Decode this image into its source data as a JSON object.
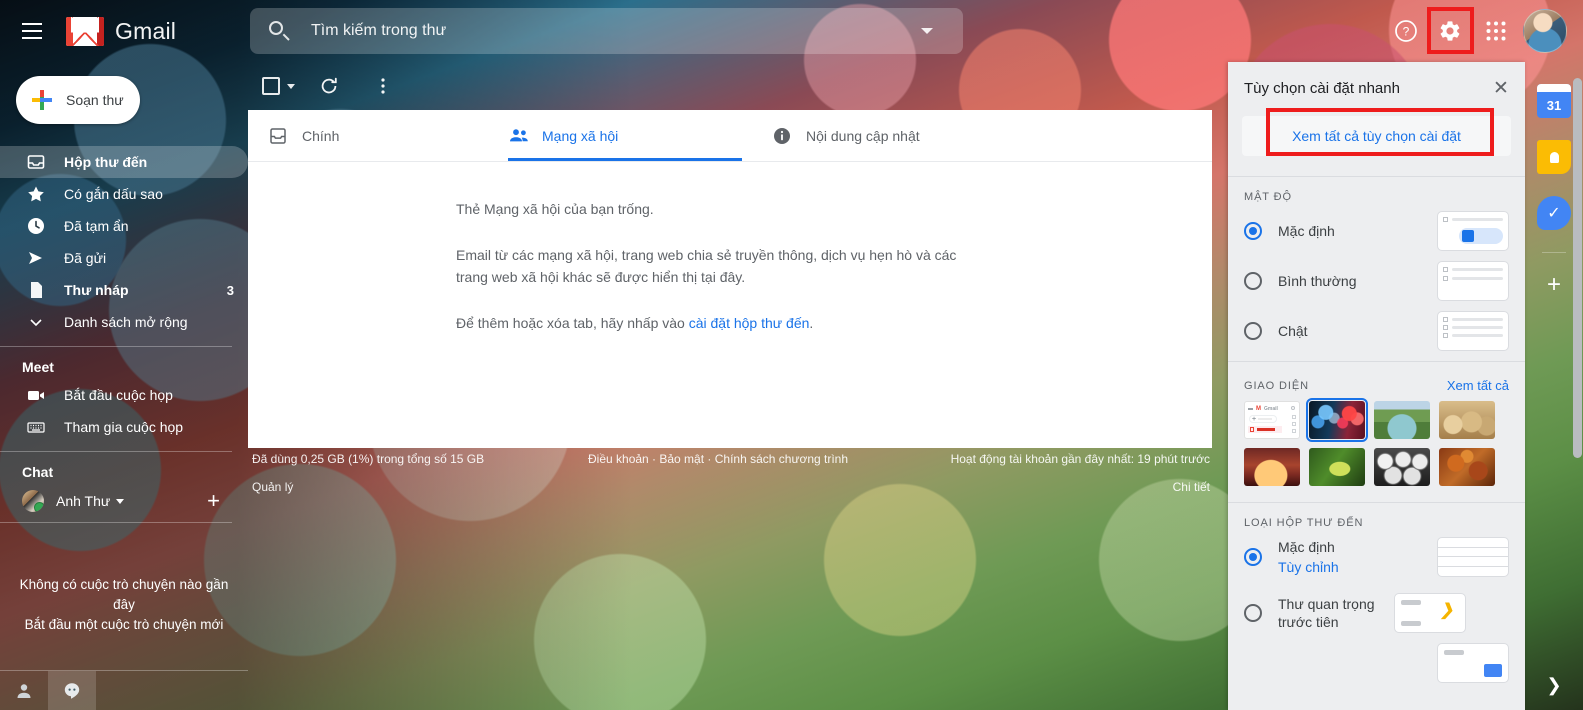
{
  "header": {
    "menu_icon": "hamburger-icon",
    "brand": "Gmail",
    "search": {
      "placeholder": "Tìm kiếm trong thư",
      "value": "",
      "search_icon": "search-icon",
      "options_icon": "chevron-down-icon"
    },
    "help_icon": "help-circle-icon",
    "settings_icon": "gear-icon",
    "apps_icon": "apps-grid-icon",
    "avatar": "user-avatar"
  },
  "sidebar": {
    "compose": {
      "label": "Soạn thư",
      "icon": "plus-icon"
    },
    "items": [
      {
        "label": "Hộp thư đến",
        "icon": "inbox-icon",
        "count": "",
        "active": true
      },
      {
        "label": "Có gắn dấu sao",
        "icon": "star-icon",
        "count": "",
        "active": false
      },
      {
        "label": "Đã tạm ẩn",
        "icon": "clock-icon",
        "count": "",
        "active": false
      },
      {
        "label": "Đã gửi",
        "icon": "send-icon",
        "count": "",
        "active": false
      },
      {
        "label": "Thư nháp",
        "icon": "draft-icon",
        "count": "3",
        "active": false
      },
      {
        "label": "Danh sách mở rộng",
        "icon": "chevron-down-icon",
        "count": "",
        "active": false
      }
    ],
    "meet": {
      "title": "Meet",
      "items": [
        {
          "label": "Bắt đầu cuộc họp",
          "icon": "video-camera-icon"
        },
        {
          "label": "Tham gia cuộc họp",
          "icon": "keyboard-icon"
        }
      ]
    },
    "chat": {
      "title": "Chat",
      "user": "Anh Thư",
      "status": "online",
      "add_icon": "plus-icon",
      "empty_line1": "Không có cuộc trò chuyện nào gần đây",
      "empty_line2": "Bắt đầu một cuộc trò chuyện mới"
    },
    "bottom_icons": [
      {
        "name": "contacts-icon",
        "selected": false
      },
      {
        "name": "hangouts-icon",
        "selected": true
      }
    ]
  },
  "toolbar": {
    "select_all_icon": "checkbox-icon",
    "select_dropdown_icon": "chevron-down-icon",
    "refresh_icon": "refresh-icon",
    "more_icon": "more-vertical-icon"
  },
  "main": {
    "tabs": [
      {
        "label": "Chính",
        "icon": "inbox-tab-icon",
        "active": false
      },
      {
        "label": "Mạng xã hội",
        "icon": "people-icon",
        "active": true
      },
      {
        "label": "Nội dung cập nhật",
        "icon": "info-icon",
        "active": false
      }
    ],
    "empty_state": {
      "heading": "Thẻ Mạng xã hội của bạn trống.",
      "body": "Email từ các mạng xã hội, trang web chia sẻ truyền thông, dịch vụ hẹn hò và các trang web xã hội khác sẽ được hiển thị tại đây.",
      "cta_prefix": "Để thêm hoặc xóa tab, hãy nhấp vào ",
      "cta_link": "cài đặt hộp thư đến",
      "cta_suffix": "."
    }
  },
  "footer": {
    "storage": "Đã dùng 0,25 GB (1%) trong tổng số 15 GB",
    "manage": "Quản lý",
    "links": "Điều khoản · Bảo mật · Chính sách chương trình",
    "activity": "Hoạt động tài khoản gần đây nhất: 19 phút trước",
    "details": "Chi tiết"
  },
  "quick_settings": {
    "title": "Tùy chọn cài đặt nhanh",
    "close_icon": "close-icon",
    "view_all": "Xem tất cả tùy chọn cài đặt",
    "density": {
      "title": "MẬT ĐỘ",
      "options": [
        {
          "label": "Mặc định",
          "selected": true
        },
        {
          "label": "Bình thường",
          "selected": false
        },
        {
          "label": "Chật",
          "selected": false
        }
      ]
    },
    "theme": {
      "title": "GIAO DIỆN",
      "view_all": "Xem tất cả",
      "items": [
        {
          "name": "light-theme",
          "selected": false
        },
        {
          "name": "bokeh-theme",
          "selected": true
        },
        {
          "name": "river-theme",
          "selected": false
        },
        {
          "name": "chess-theme",
          "selected": false
        },
        {
          "name": "canyon-theme",
          "selected": false
        },
        {
          "name": "leaf-theme",
          "selected": false
        },
        {
          "name": "spheres-theme",
          "selected": false
        },
        {
          "name": "autumn-theme",
          "selected": false
        }
      ]
    },
    "inbox_type": {
      "title": "LOẠI HỘP THƯ ĐẾN",
      "options": [
        {
          "label": "Mặc định",
          "sub": "Tùy chỉnh",
          "selected": true
        },
        {
          "label": "Thư quan trọng trước tiên",
          "sub": "",
          "selected": false
        }
      ]
    }
  },
  "side_strip": {
    "icons": [
      {
        "name": "google-calendar-icon",
        "label": "31"
      },
      {
        "name": "google-keep-icon",
        "label": ""
      },
      {
        "name": "google-tasks-icon",
        "label": "✓"
      }
    ],
    "add_icon": "plus-icon",
    "expand_icon": "chevron-right-icon"
  },
  "highlights": {
    "settings_button": "#ee1c1c",
    "view_all_settings": "#ee1c1c"
  },
  "colors": {
    "accent_blue": "#1a73e8",
    "gmail_red": "#ea4335",
    "panel_bg": "#edeef0"
  }
}
